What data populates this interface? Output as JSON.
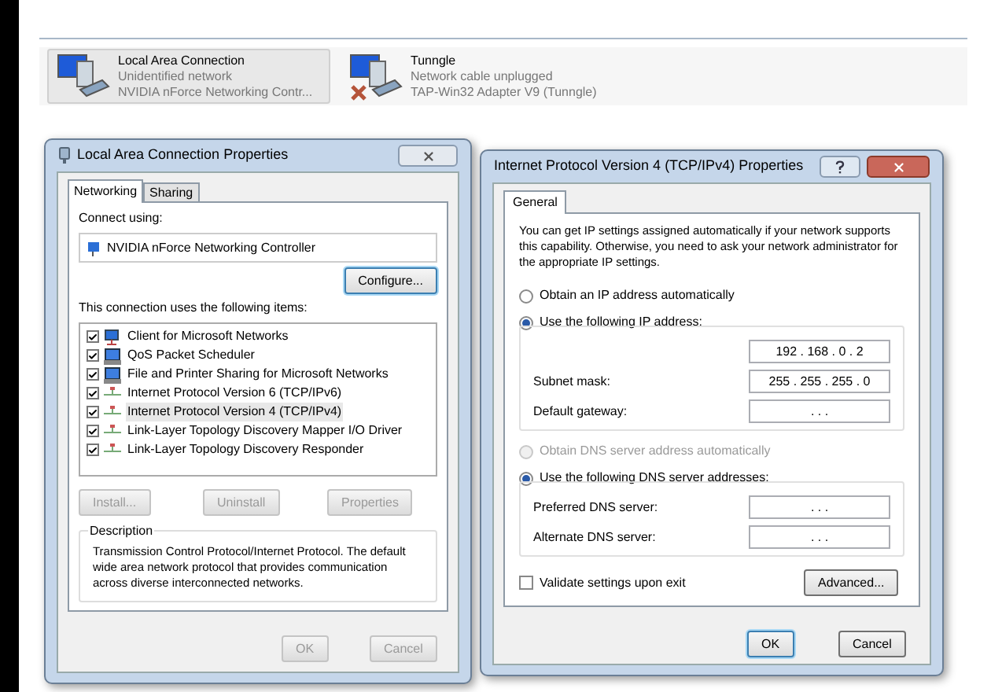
{
  "connections": [
    {
      "name": "Local Area Connection",
      "status": "Unidentified network",
      "adapter": "NVIDIA nForce Networking Contr...",
      "selected": true,
      "unplugged": false
    },
    {
      "name": "Tunngle",
      "status": "Network cable unplugged",
      "adapter": "TAP-Win32 Adapter V9 (Tunngle)",
      "selected": false,
      "unplugged": true
    }
  ],
  "lan_dialog": {
    "title": "Local Area Connection Properties",
    "tabs": [
      {
        "label": "Networking",
        "selected": true
      },
      {
        "label": "Sharing",
        "selected": false
      }
    ],
    "connect_using_label": "Connect using:",
    "adapter": "NVIDIA nForce Networking Controller",
    "configure_button": "Configure...",
    "items_label": "This connection uses the following items:",
    "items": [
      {
        "label": "Client for Microsoft Networks",
        "checked": true,
        "selected": false,
        "kind": "client"
      },
      {
        "label": "QoS Packet Scheduler",
        "checked": true,
        "selected": false,
        "kind": "service"
      },
      {
        "label": "File and Printer Sharing for Microsoft Networks",
        "checked": true,
        "selected": false,
        "kind": "service"
      },
      {
        "label": "Internet Protocol Version 6 (TCP/IPv6)",
        "checked": true,
        "selected": false,
        "kind": "protocol"
      },
      {
        "label": "Internet Protocol Version 4 (TCP/IPv4)",
        "checked": true,
        "selected": true,
        "kind": "protocol"
      },
      {
        "label": "Link-Layer Topology Discovery Mapper I/O Driver",
        "checked": true,
        "selected": false,
        "kind": "protocol"
      },
      {
        "label": "Link-Layer Topology Discovery Responder",
        "checked": true,
        "selected": false,
        "kind": "protocol"
      }
    ],
    "item_buttons": [
      {
        "label": "Install...",
        "disabled": true
      },
      {
        "label": "Uninstall",
        "disabled": true
      },
      {
        "label": "Properties",
        "disabled": true
      }
    ],
    "description": {
      "title": "Description",
      "text": "Transmission Control Protocol/Internet Protocol. The default wide area network protocol that provides communication across diverse interconnected networks."
    },
    "footer_buttons": [
      {
        "label": "OK",
        "disabled": true
      },
      {
        "label": "Cancel",
        "disabled": true
      }
    ]
  },
  "ipv4_dialog": {
    "title": "Internet Protocol Version 4 (TCP/IPv4) Properties",
    "tabs": [
      {
        "label": "General",
        "selected": true
      }
    ],
    "intro": "You can get IP settings assigned automatically if your network supports this capability. Otherwise, you need to ask your network administrator for the appropriate IP settings.",
    "ip_options": [
      {
        "label": "Obtain an IP address automatically",
        "selected": false,
        "disabled": false
      },
      {
        "label": "Use the following IP address:",
        "selected": true,
        "disabled": false
      }
    ],
    "ip_fields": [
      {
        "value": "192 . 168 . 0 . 2"
      },
      {
        "label": "Subnet mask:",
        "value": "255 . 255 . 255 . 0"
      },
      {
        "label": "Default gateway:",
        "value": ". . ."
      }
    ],
    "dns_options": [
      {
        "label": "Obtain DNS server address automatically",
        "selected": false,
        "disabled": true
      },
      {
        "label": "Use the following DNS server addresses:",
        "selected": true,
        "disabled": false
      }
    ],
    "dns_fields": [
      {
        "label": "Preferred DNS server:",
        "value": ". . ."
      },
      {
        "label": "Alternate DNS server:",
        "value": ". . ."
      }
    ],
    "validate": {
      "label": "Validate settings upon exit",
      "checked": false
    },
    "advanced_button": "Advanced...",
    "footer_buttons": [
      {
        "label": "OK",
        "default": true
      },
      {
        "label": "Cancel",
        "default": false
      }
    ]
  }
}
